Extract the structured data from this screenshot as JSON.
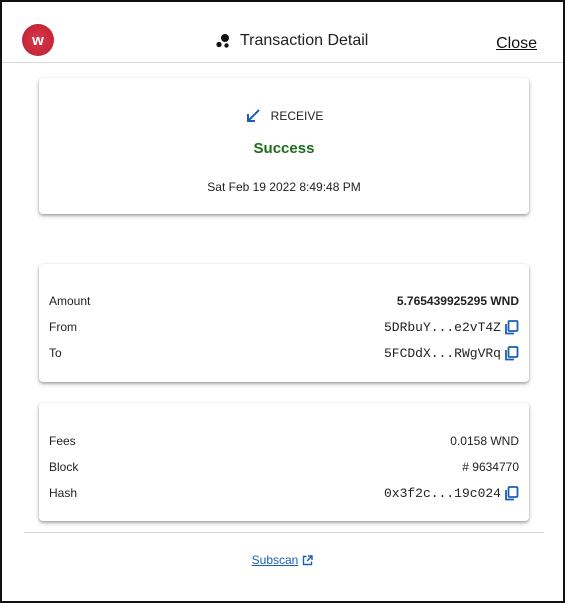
{
  "header": {
    "logo_letter": "w",
    "title": "Transaction Detail",
    "close_label": "Close"
  },
  "status_card": {
    "direction": "RECEIVE",
    "status": "Success",
    "datetime": "Sat Feb 19 2022 8:49:48 PM"
  },
  "transfer_card": {
    "amount_label": "Amount",
    "amount_value": "5.765439925295 WND",
    "from_label": "From",
    "from_value": "5DRbuY...e2vT4Z",
    "to_label": "To",
    "to_value": "5FCDdX...RWgVRq"
  },
  "chain_card": {
    "fees_label": "Fees",
    "fees_value": "0.0158 WND",
    "block_label": "Block",
    "block_value": "# 9634770",
    "hash_label": "Hash",
    "hash_value": "0x3f2c...19c024"
  },
  "footer": {
    "subscan_label": "Subscan"
  },
  "colors": {
    "success": "#1e6b1e",
    "accent_blue": "#1a5fb4",
    "logo_red": "#c8283b"
  },
  "icons": {
    "logo": "westend-logo-icon",
    "title": "transaction-dots-icon",
    "direction": "arrow-down-left-icon",
    "copy": "copy-icon",
    "external": "external-link-icon"
  }
}
